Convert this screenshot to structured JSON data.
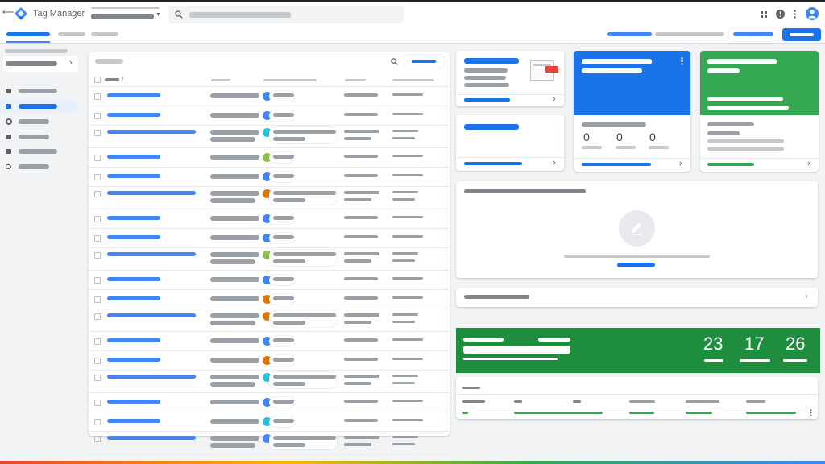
{
  "app": {
    "title": "Tag Manager"
  },
  "summary": {
    "changes": {
      "counts": [
        "0",
        "0",
        "0"
      ]
    },
    "countdown": {
      "values": [
        "23",
        "17",
        "26"
      ]
    }
  },
  "table": {
    "rows": [
      {
        "tall": false,
        "dot_color": "#4285f4"
      },
      {
        "tall": false,
        "dot_color": "#4285f4"
      },
      {
        "tall": true,
        "dot_color": "#24c1e0"
      },
      {
        "tall": false,
        "dot_color": "#8bc34a"
      },
      {
        "tall": false,
        "dot_color": "#4285f4"
      },
      {
        "tall": true,
        "dot_color": "#e37400"
      },
      {
        "tall": false,
        "dot_color": "#4285f4"
      },
      {
        "tall": false,
        "dot_color": "#4285f4"
      },
      {
        "tall": true,
        "dot_color": "#8bc34a"
      },
      {
        "tall": false,
        "dot_color": "#4285f4"
      },
      {
        "tall": false,
        "dot_color": "#e37400"
      },
      {
        "tall": true,
        "dot_color": "#e37400"
      },
      {
        "tall": false,
        "dot_color": "#4285f4"
      },
      {
        "tall": false,
        "dot_color": "#e37400"
      },
      {
        "tall": true,
        "dot_color": "#24c1e0"
      },
      {
        "tall": false,
        "dot_color": "#4285f4"
      },
      {
        "tall": false,
        "dot_color": "#24c1e0"
      },
      {
        "tall": true,
        "dot_color": "#4285f4"
      }
    ]
  },
  "colors": {
    "primary": "#1a73e8",
    "blue_card": "#1a73e8",
    "green_card": "#34a853",
    "countdown_banner": "#1e8e3e",
    "alert_red": "#ea4335"
  },
  "icons": [
    "back-arrow-icon",
    "tag-manager-logo-icon",
    "search-icon",
    "apps-grid-icon",
    "help-icon",
    "more-vert-icon",
    "account-avatar-icon",
    "folder-icon",
    "tag-icon",
    "trigger-icon",
    "variable-icon",
    "template-icon",
    "chevron-right-icon",
    "edit-pencil-icon"
  ]
}
